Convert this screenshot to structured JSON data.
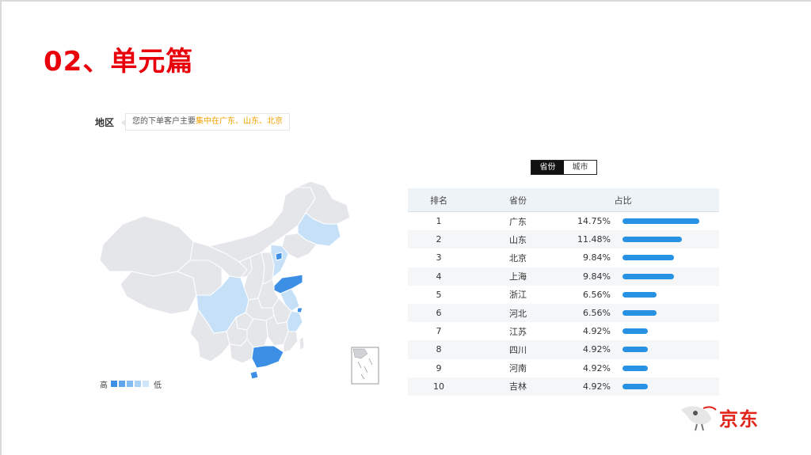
{
  "slide": {
    "title": "02、单元篇"
  },
  "region": {
    "label": "地区",
    "summary_prefix": "您的下单客户主要",
    "summary_highlight": "集中在广东、山东、北京"
  },
  "legend": {
    "high": "高",
    "low": "低",
    "colors": [
      "#3d8fe6",
      "#5ea5ec",
      "#82bbf0",
      "#a9d1f5",
      "#cfe5fa"
    ]
  },
  "map_colors": {
    "base": "#e4e6e9",
    "border": "#ffffff",
    "top": "#3d8fe6",
    "mid": "#c6e0f8"
  },
  "toggle": {
    "options": [
      "省份",
      "城市"
    ],
    "active": "省份"
  },
  "table": {
    "headers": {
      "rank": "排名",
      "province": "省份",
      "share": "占比"
    },
    "rows": [
      {
        "rank": "1",
        "province": "广东",
        "pct": "14.75%",
        "value": 14.75
      },
      {
        "rank": "2",
        "province": "山东",
        "pct": "11.48%",
        "value": 11.48
      },
      {
        "rank": "3",
        "province": "北京",
        "pct": "9.84%",
        "value": 9.84
      },
      {
        "rank": "4",
        "province": "上海",
        "pct": "9.84%",
        "value": 9.84
      },
      {
        "rank": "5",
        "province": "浙江",
        "pct": "6.56%",
        "value": 6.56
      },
      {
        "rank": "6",
        "province": "河北",
        "pct": "6.56%",
        "value": 6.56
      },
      {
        "rank": "7",
        "province": "江苏",
        "pct": "4.92%",
        "value": 4.92
      },
      {
        "rank": "8",
        "province": "四川",
        "pct": "4.92%",
        "value": 4.92
      },
      {
        "rank": "9",
        "province": "河南",
        "pct": "4.92%",
        "value": 4.92
      },
      {
        "rank": "10",
        "province": "吉林",
        "pct": "4.92%",
        "value": 4.92
      }
    ],
    "bar_color": "#2792e3"
  },
  "brand": {
    "name": "京东"
  }
}
